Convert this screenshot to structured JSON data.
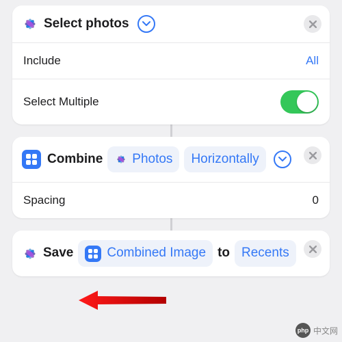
{
  "action1": {
    "title": "Select photos",
    "rows": {
      "include": {
        "label": "Include",
        "value": "All"
      },
      "multiple": {
        "label": "Select Multiple",
        "toggle": true
      }
    }
  },
  "action2": {
    "verb": "Combine",
    "param_source": "Photos",
    "param_direction": "Horizontally",
    "rows": {
      "spacing": {
        "label": "Spacing",
        "value": "0"
      }
    }
  },
  "action3": {
    "verb": "Save",
    "param_input": "Combined Image",
    "word_to": "to",
    "param_album": "Recents"
  },
  "watermark": "中文网"
}
